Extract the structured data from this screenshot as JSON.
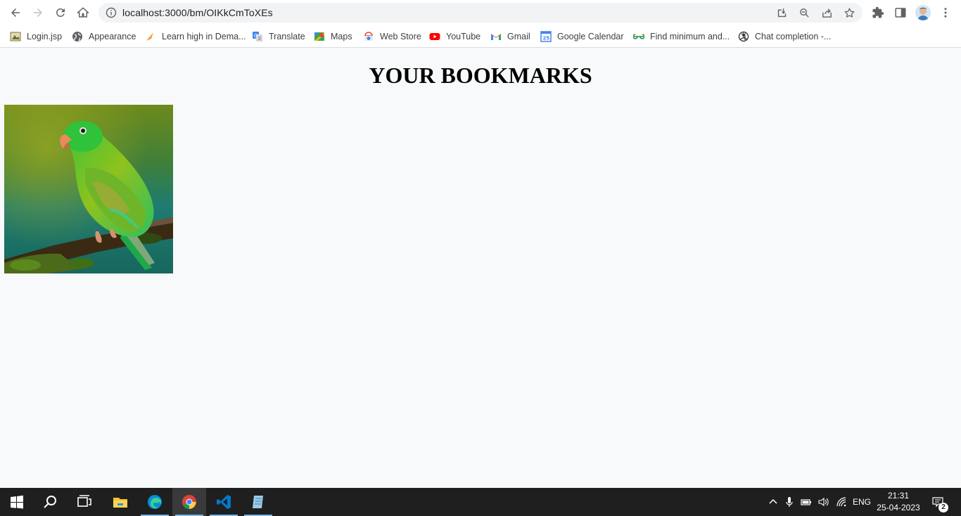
{
  "browser": {
    "url": "localhost:3000/bm/OIKkCmToXEs"
  },
  "bookmarks_bar": [
    {
      "label": "Login.jsp",
      "icon": "login-page-icon"
    },
    {
      "label": "Appearance",
      "icon": "globe-icon"
    },
    {
      "label": "Learn high in Dema...",
      "icon": "learn-icon"
    },
    {
      "label": "Translate",
      "icon": "translate-icon"
    },
    {
      "label": "Maps",
      "icon": "maps-icon"
    },
    {
      "label": "Web Store",
      "icon": "webstore-icon"
    },
    {
      "label": "YouTube",
      "icon": "youtube-icon"
    },
    {
      "label": "Gmail",
      "icon": "gmail-icon"
    },
    {
      "label": "Google Calendar",
      "icon": "calendar-icon",
      "badge": "25"
    },
    {
      "label": "Find minimum and...",
      "icon": "geeksforgeeks-icon"
    },
    {
      "label": "Chat completion -...",
      "icon": "openai-icon"
    }
  ],
  "page": {
    "title": "YOUR BOOKMARKS",
    "image_alt": "green parrot on a branch"
  },
  "taskbar": {
    "apps": [
      "start-icon",
      "search-icon",
      "task-view-icon",
      "file-explorer-icon",
      "edge-icon",
      "chrome-icon",
      "vscode-icon",
      "notepad-icon"
    ],
    "language": "ENG",
    "time": "21:31",
    "date": "25-04-2023",
    "notifications": "2"
  },
  "colors": {
    "page_background": "#f8f9fa",
    "taskbar": "#1f1f1f",
    "taskbar_accent": "#76b9ed"
  }
}
